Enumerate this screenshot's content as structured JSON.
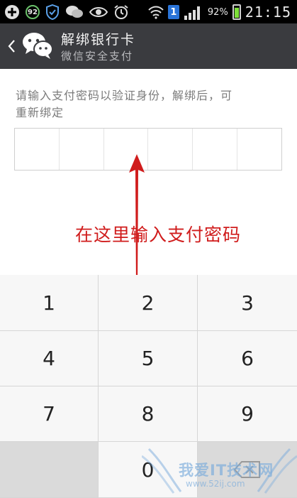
{
  "status_bar": {
    "notification_badge": "92",
    "sim_label": "1",
    "battery_percent": "92%",
    "time": "21:15",
    "icons": [
      "add-icon",
      "security-badge-icon",
      "shield-icon",
      "wechat-icon",
      "eye-icon",
      "alarm-icon",
      "wifi-icon",
      "sim-icon",
      "signal-icon",
      "battery-icon"
    ]
  },
  "header": {
    "title": "解绑银行卡",
    "subtitle": "微信安全支付",
    "back_icon": "chevron-left-icon",
    "logo_icon": "wechat-logo-icon"
  },
  "main": {
    "prompt_line1": "请输入支付密码以验证身份，解绑后，可",
    "prompt_line2": "重新绑定",
    "pin_length": 6,
    "annotation": "在这里输入支付密码"
  },
  "keypad": {
    "keys": [
      "1",
      "2",
      "3",
      "4",
      "5",
      "6",
      "7",
      "8",
      "9",
      "",
      "0",
      "delete"
    ]
  },
  "watermark": {
    "text": "我爱IT技术网",
    "url": "www.52ij.com"
  },
  "colors": {
    "titlebar": "#3a3b3f",
    "annotation": "#d01c1c",
    "keypad_key": "#f7f7f7",
    "keypad_blank": "#dadada"
  }
}
